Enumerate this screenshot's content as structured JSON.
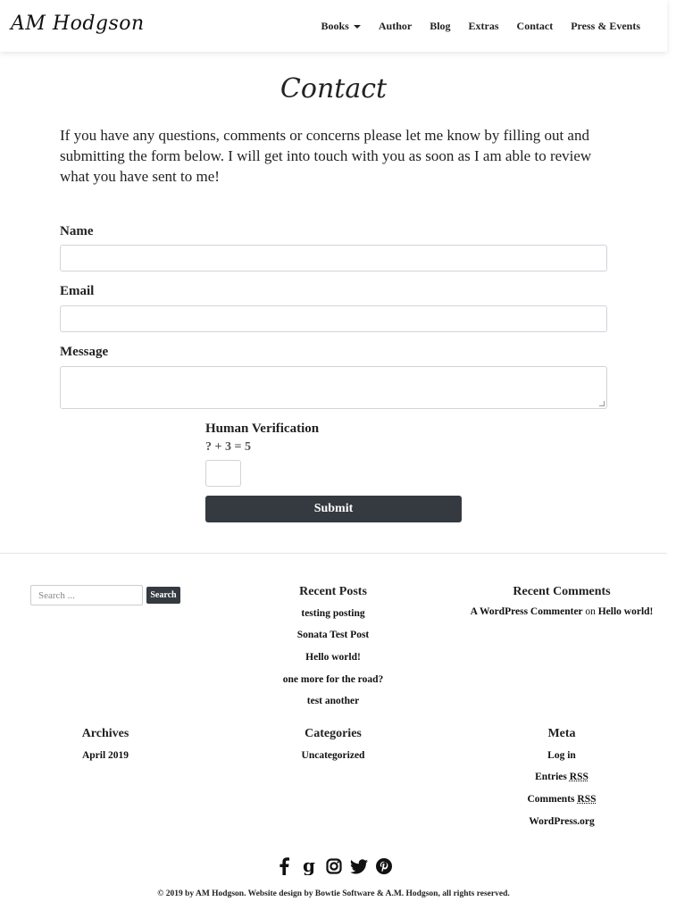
{
  "brand": "AM Hodgson",
  "nav": {
    "items": [
      "Books",
      "Author",
      "Blog",
      "Extras",
      "Contact",
      "Press & Events"
    ]
  },
  "page": {
    "title": "Contact",
    "intro": "If you have any questions, comments or concerns please let me know by filling out and submitting the form below. I will get into touch with you as soon as I am able to review what you have sent to me!"
  },
  "form": {
    "name_label": "Name",
    "email_label": "Email",
    "message_label": "Message",
    "verification_label": "Human Verification",
    "verification_question": "? + 3 = 5",
    "submit_label": "Submit"
  },
  "footer": {
    "search_placeholder": "Search ...",
    "search_button": "Search",
    "recent_posts_title": "Recent Posts",
    "recent_posts": [
      "testing posting",
      "Sonata Test Post",
      "Hello world!",
      "one more for the road?",
      "test another"
    ],
    "recent_comments_title": "Recent Comments",
    "recent_comment": {
      "author": "A WordPress Commenter",
      "on": "on",
      "post": "Hello world!"
    },
    "archives_title": "Archives",
    "archives": [
      "April 2019"
    ],
    "categories_title": "Categories",
    "categories": [
      "Uncategorized"
    ],
    "meta_title": "Meta",
    "meta": {
      "login": "Log in",
      "entries_prefix": "Entries ",
      "comments_prefix": "Comments ",
      "rss": "RSS",
      "wordpress": "WordPress.org"
    },
    "social_icons": [
      "facebook-icon",
      "goodreads-icon",
      "instagram-icon",
      "twitter-icon",
      "pinterest-icon"
    ],
    "copyright": "© 2019 by AM Hodgson. Website design by Bowtie Software & A.M. Hodgson, all rights reserved."
  }
}
